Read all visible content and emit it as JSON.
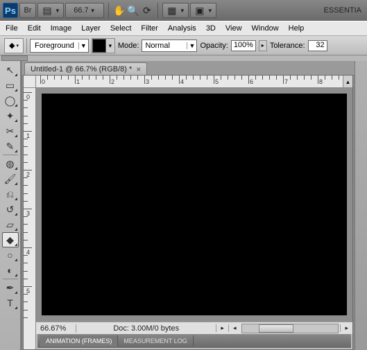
{
  "appbar": {
    "logo_text": "Ps",
    "bridge_label": "Br",
    "zoom_label": "66.7",
    "workspace_label": "ESSENTIA"
  },
  "menu": {
    "items": [
      "File",
      "Edit",
      "Image",
      "Layer",
      "Select",
      "Filter",
      "Analysis",
      "3D",
      "View",
      "Window",
      "Help"
    ]
  },
  "options": {
    "fill_label": "Foreground",
    "mode_label": "Mode:",
    "mode_value": "Normal",
    "opacity_label": "Opacity:",
    "opacity_value": "100%",
    "tolerance_label": "Tolerance:",
    "tolerance_value": "32"
  },
  "document": {
    "tab_title": "Untitled-1 @ 66.7% (RGB/8) *",
    "status_zoom": "66.67%",
    "status_doc": "Doc: 3.00M/0 bytes"
  },
  "ruler_top_labels": [
    "0",
    "1",
    "2",
    "3",
    "4",
    "5",
    "6",
    "7",
    "8"
  ],
  "ruler_left_labels": [
    "0",
    "1",
    "2",
    "3",
    "4",
    "5"
  ],
  "bottom_tabs": {
    "animation": "ANIMATION (FRAMES)",
    "measurement": "MEASUREMENT LOG"
  },
  "tools": [
    {
      "name": "move-tool",
      "glyph": "↖"
    },
    {
      "name": "marquee-tool",
      "glyph": "▭"
    },
    {
      "name": "lasso-tool",
      "glyph": "◯"
    },
    {
      "name": "magic-wand-tool",
      "glyph": "✦"
    },
    {
      "name": "crop-tool",
      "glyph": "✂"
    },
    {
      "name": "eyedropper-tool",
      "glyph": "✎"
    },
    {
      "name": "healing-brush-tool",
      "glyph": "◍"
    },
    {
      "name": "brush-tool",
      "glyph": "🖌"
    },
    {
      "name": "clone-stamp-tool",
      "glyph": "⎌"
    },
    {
      "name": "history-brush-tool",
      "glyph": "↺"
    },
    {
      "name": "eraser-tool",
      "glyph": "▱"
    },
    {
      "name": "paint-bucket-tool",
      "glyph": "◆",
      "selected": true
    },
    {
      "name": "blur-tool",
      "glyph": "○"
    },
    {
      "name": "dodge-tool",
      "glyph": "◐"
    },
    {
      "name": "pen-tool",
      "glyph": "✒"
    },
    {
      "name": "type-tool",
      "glyph": "T"
    }
  ]
}
